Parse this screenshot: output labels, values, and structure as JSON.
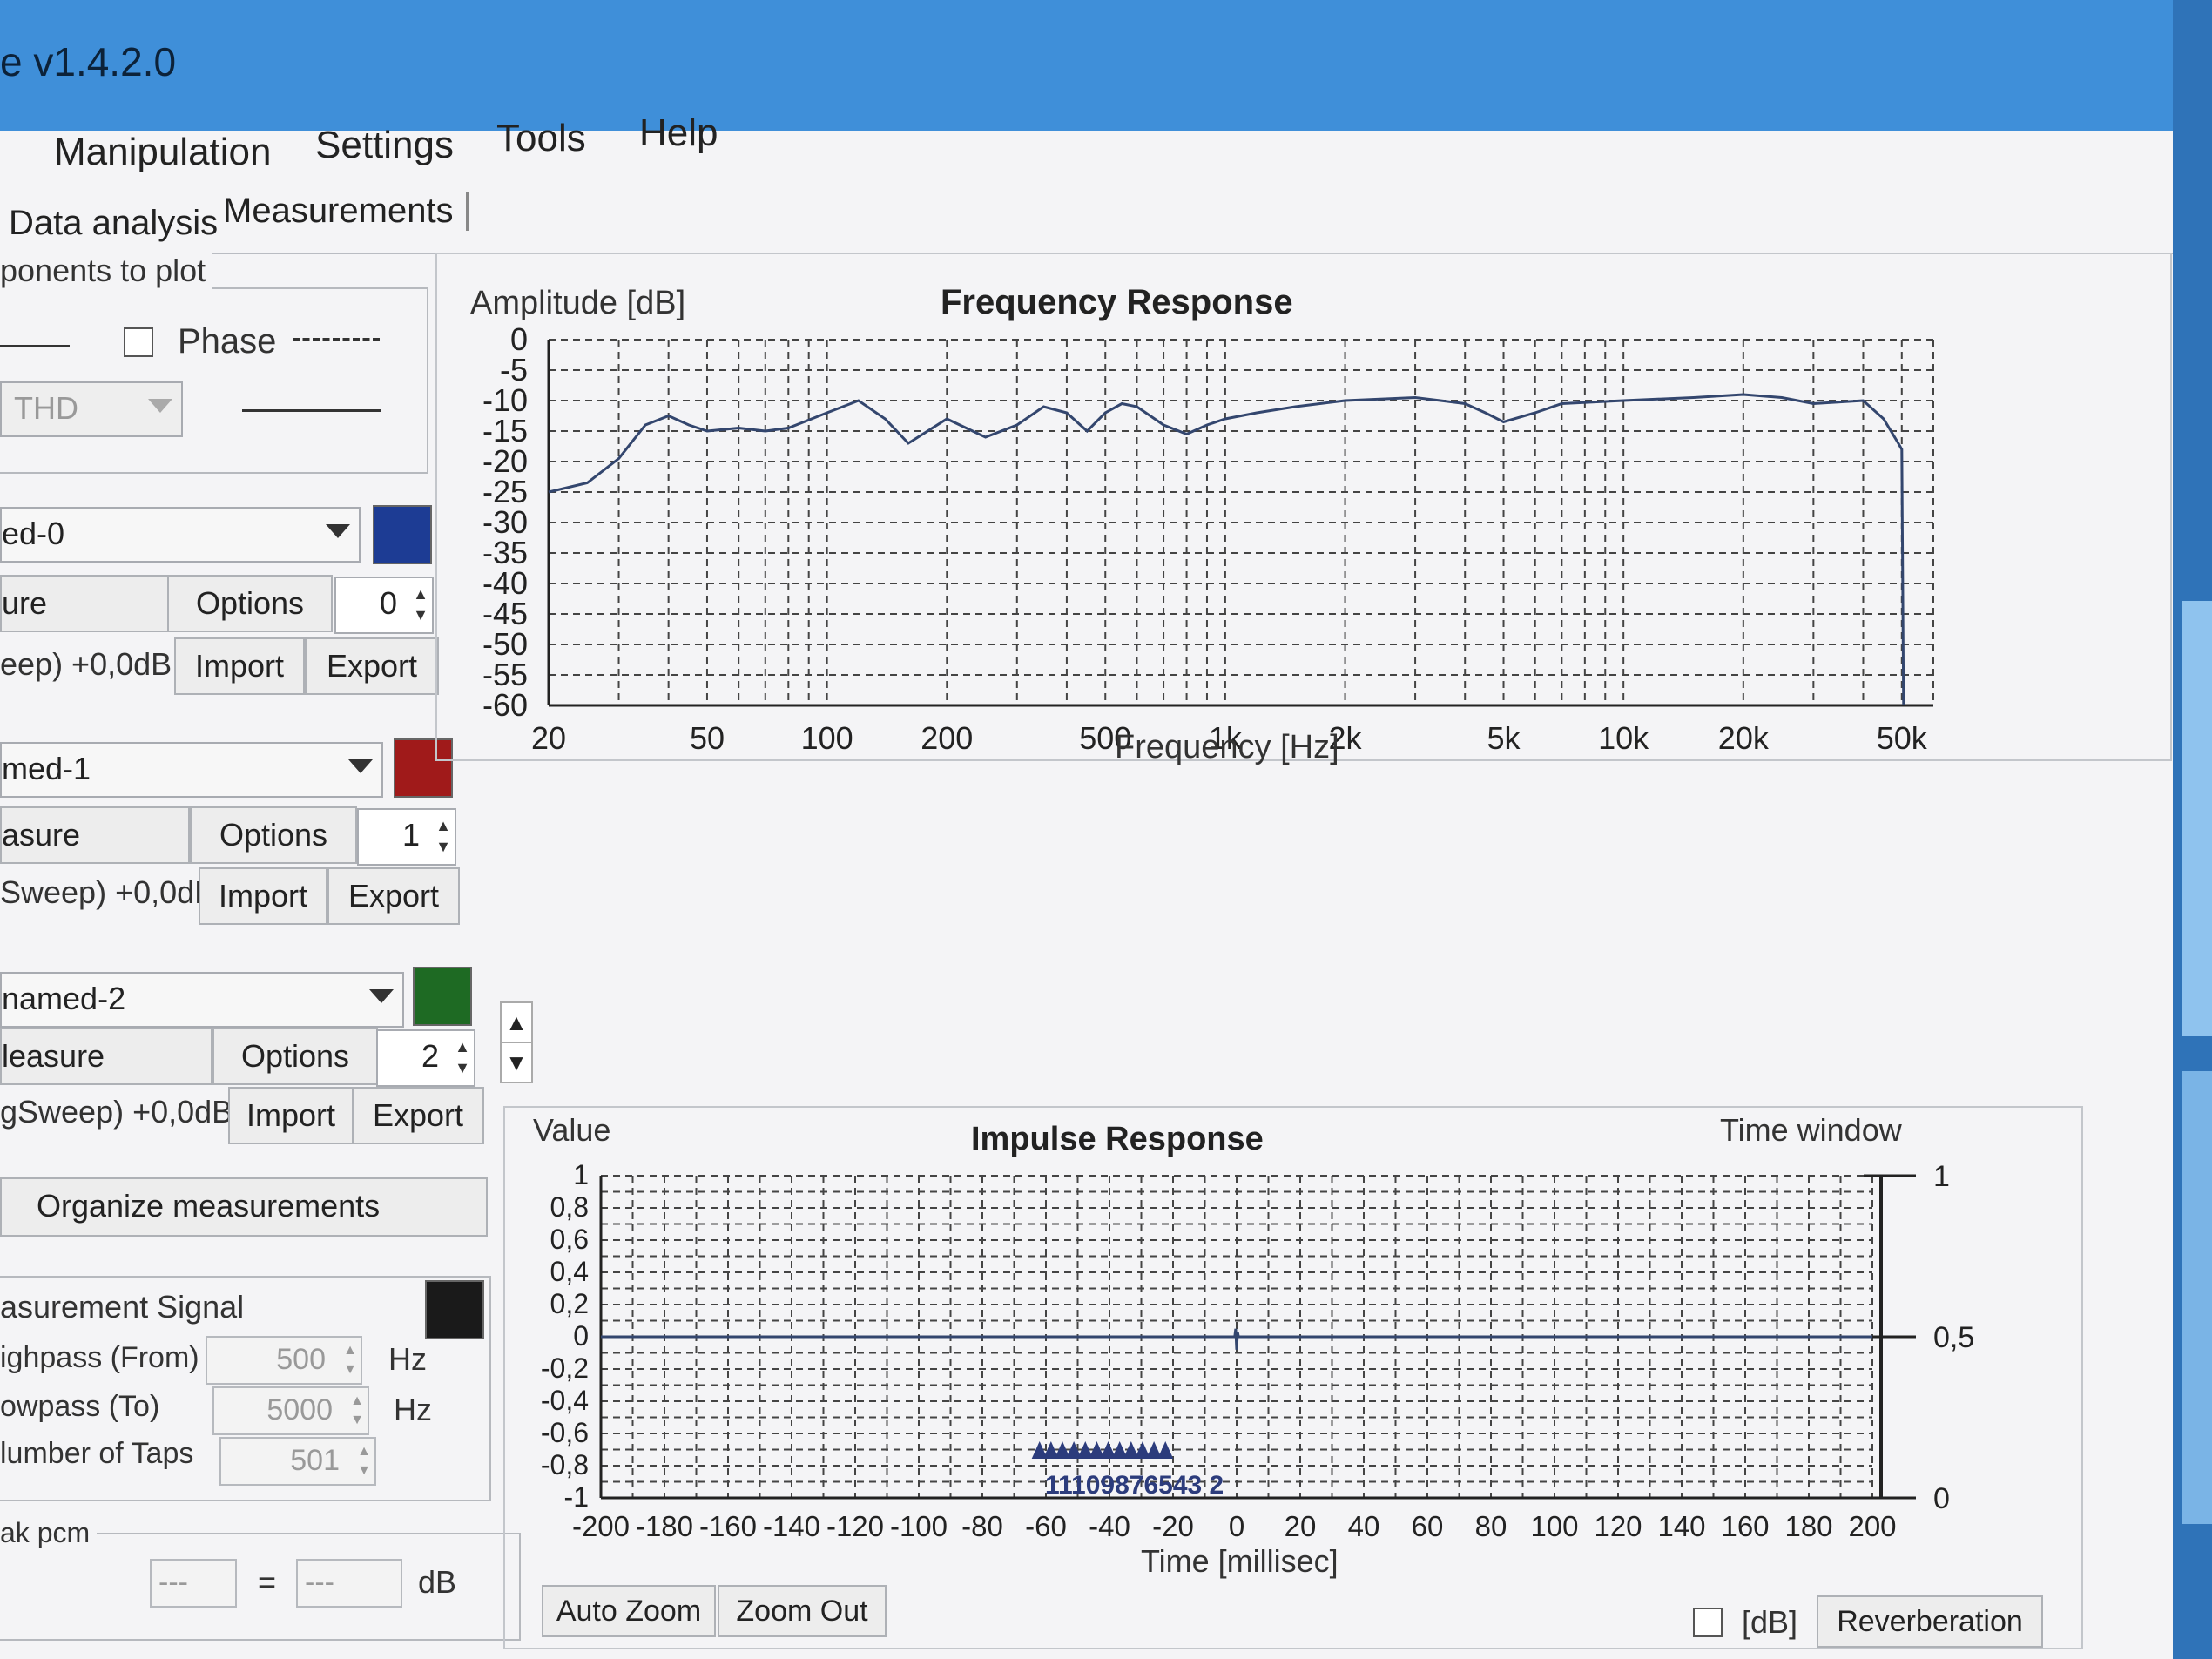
{
  "window": {
    "title": "e v1.4.2.0"
  },
  "menu": {
    "items": [
      "Manipulation",
      "Settings",
      "Tools",
      "Help"
    ]
  },
  "tabs": [
    "Data analysis",
    "Measurements"
  ],
  "components": {
    "legend": "ponents to plot",
    "phase_label": "Phase",
    "phase_checked": false,
    "thd_value": "THD"
  },
  "measurements": [
    {
      "name": "ed-0",
      "color": "#1d3c94",
      "measure_label": "ure",
      "options_label": "Options",
      "index": "0",
      "signal": "eep) +0,0dB",
      "import_label": "Import",
      "export_label": "Export"
    },
    {
      "name": "med-1",
      "color": "#a01a1a",
      "measure_label": "asure",
      "options_label": "Options",
      "index": "1",
      "signal": "Sweep) +0,0dB",
      "import_label": "Import",
      "export_label": "Export"
    },
    {
      "name": "named-2",
      "color": "#1e6a23",
      "measure_label": "leasure",
      "options_label": "Options",
      "index": "2",
      "signal": "gSweep) +0,0dB",
      "import_label": "Import",
      "export_label": "Export"
    }
  ],
  "organize_label": "Organize measurements",
  "signal": {
    "label": "asurement Signal",
    "color": "#1a1a1a",
    "highpass_label": "ighpass (From)",
    "highpass_value": "500",
    "lowpass_label": "owpass (To)",
    "lowpass_value": "5000",
    "taps_label": "lumber of Taps",
    "taps_value": "501",
    "unit_hz": "Hz"
  },
  "peak": {
    "label": "ak pcm",
    "val1": "---",
    "eq": "=",
    "val2": "---",
    "unit": "dB"
  },
  "freq_chart": {
    "title": "Frequency Response",
    "ylabel": "Amplitude [dB]",
    "xlabel": "Frequency [Hz]",
    "y_ticks": [
      "0",
      "-5",
      "-10",
      "-15",
      "-20",
      "-25",
      "-30",
      "-35",
      "-40",
      "-45",
      "-50",
      "-55",
      "-60"
    ],
    "x_ticks": [
      "20",
      "50",
      "100",
      "200",
      "500",
      "1k",
      "2k",
      "5k",
      "10k",
      "20k",
      "50k"
    ]
  },
  "impulse_chart": {
    "title": "Impulse Response",
    "ylabel": "Value",
    "xlabel": "Time [millisec]",
    "right_label": "Time window",
    "y_ticks": [
      "1",
      "0,8",
      "0,6",
      "0,4",
      "0,2",
      "0",
      "-0,2",
      "-0,4",
      "-0,6",
      "-0,8",
      "-1"
    ],
    "x_ticks": [
      "-200",
      "-180",
      "-160",
      "-140",
      "-120",
      "-100",
      "-80",
      "-60",
      "-40",
      "-20",
      "0",
      "20",
      "40",
      "60",
      "80",
      "100",
      "120",
      "140",
      "160",
      "180",
      "200"
    ],
    "right_ticks": [
      "1",
      "0,5",
      "0"
    ],
    "markers": "11109876543 2"
  },
  "chart_data": [
    {
      "type": "line",
      "title": "Frequency Response",
      "xlabel": "Frequency [Hz]",
      "ylabel": "Amplitude [dB]",
      "xscale": "log",
      "xlim": [
        20,
        60000
      ],
      "ylim": [
        -60,
        0
      ],
      "grid": true,
      "series": [
        {
          "color": "#33466e",
          "x": [
            20,
            25,
            30,
            35,
            40,
            45,
            50,
            60,
            70,
            80,
            100,
            120,
            140,
            160,
            200,
            250,
            300,
            350,
            400,
            450,
            500,
            550,
            600,
            700,
            800,
            900,
            1000,
            1200,
            1500,
            2000,
            3000,
            4000,
            4500,
            5000,
            6000,
            7000,
            10000,
            15000,
            20000,
            25000,
            30000,
            40000,
            45000,
            49000,
            50000,
            50500
          ],
          "y": [
            -25,
            -23.5,
            -19.5,
            -14,
            -12.5,
            -14,
            -15,
            -14.5,
            -15,
            -14.5,
            -12,
            -10,
            -13,
            -17,
            -13,
            -16,
            -14,
            -11,
            -12,
            -15,
            -12,
            -10.5,
            -11,
            -14,
            -15.5,
            -14,
            -13,
            -12,
            -11,
            -10,
            -9.5,
            -10.5,
            -12,
            -13.5,
            -12,
            -10.5,
            -10,
            -9.5,
            -9,
            -9.5,
            -10.5,
            -10,
            -13,
            -17,
            -18,
            -60
          ]
        }
      ]
    },
    {
      "type": "line",
      "title": "Impulse Response",
      "xlabel": "Time [millisec]",
      "ylabel": "Value",
      "xlim": [
        -200,
        200
      ],
      "ylim": [
        -1,
        1
      ],
      "grid": true,
      "series": [
        {
          "color": "#33466e",
          "x": [
            -200,
            -0.6,
            -0.3,
            0,
            0.3,
            0.6,
            200
          ],
          "y": [
            0,
            0,
            0.05,
            -0.08,
            0.03,
            0,
            0
          ]
        }
      ]
    }
  ]
}
